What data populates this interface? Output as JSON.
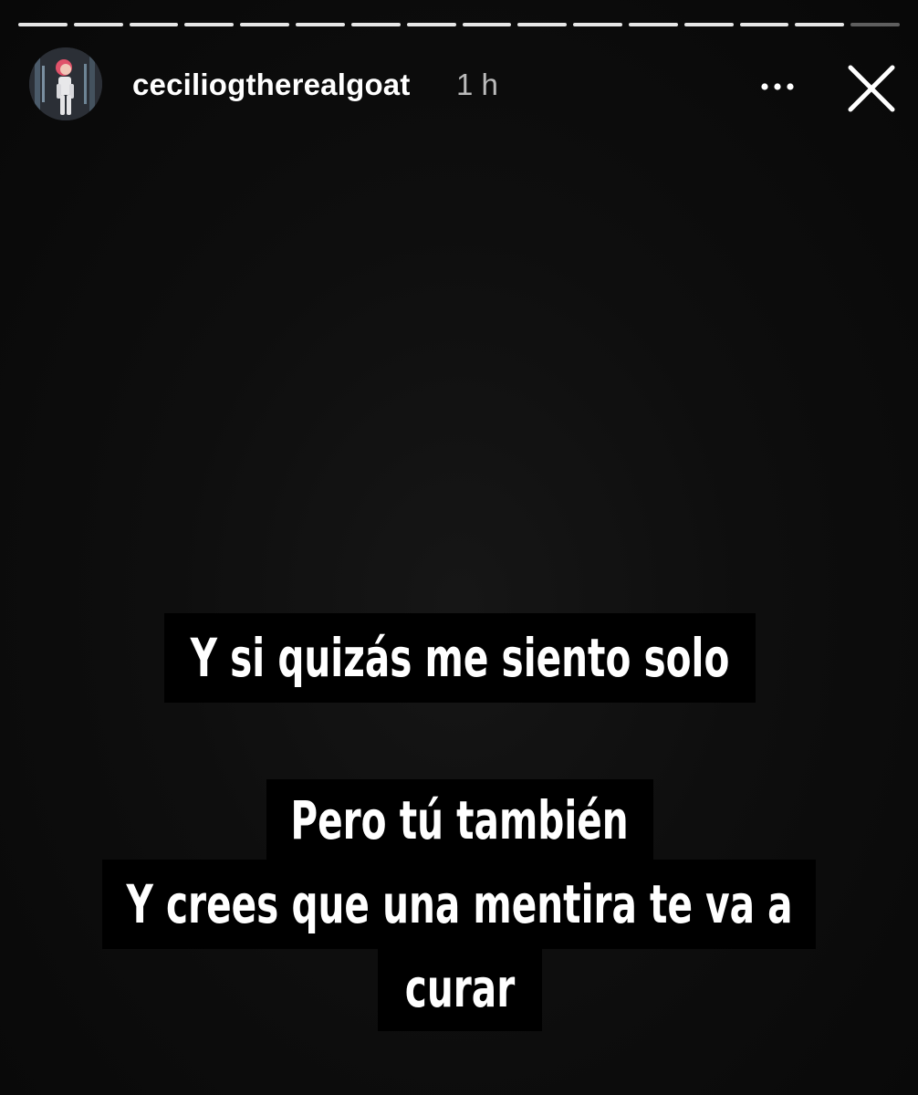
{
  "story": {
    "progress_total": 16,
    "progress_seen": 15
  },
  "header": {
    "username": "ceciliogtherealgoat",
    "time_ago": "1 h",
    "more_icon": "more-horizontal-icon",
    "close_icon": "close-icon"
  },
  "caption": {
    "line1": "Y si quizás me siento solo",
    "line2": "Pero tú también",
    "line3": "Y  crees que una mentira te va a",
    "line4": "curar"
  },
  "colors": {
    "background": "#0d0d0d",
    "caption_bg": "#000000",
    "text": "#ffffff"
  }
}
